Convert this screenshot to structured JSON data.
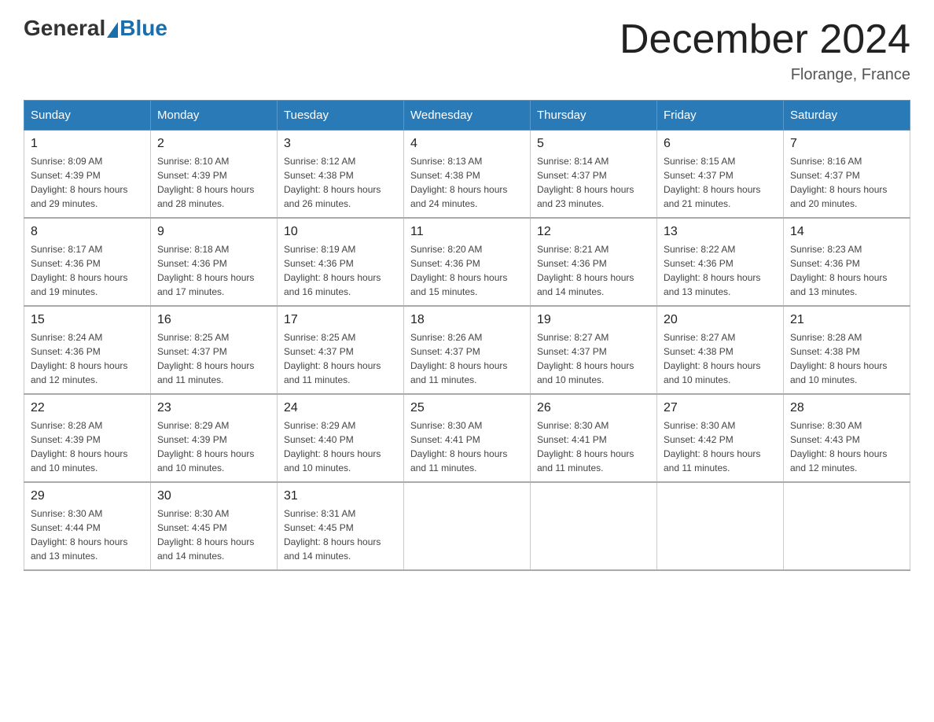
{
  "header": {
    "title": "December 2024",
    "subtitle": "Florange, France",
    "logo_general": "General",
    "logo_blue": "Blue"
  },
  "columns": [
    "Sunday",
    "Monday",
    "Tuesday",
    "Wednesday",
    "Thursday",
    "Friday",
    "Saturday"
  ],
  "weeks": [
    [
      {
        "day": "1",
        "sunrise": "8:09 AM",
        "sunset": "4:39 PM",
        "daylight": "8 hours and 29 minutes."
      },
      {
        "day": "2",
        "sunrise": "8:10 AM",
        "sunset": "4:39 PM",
        "daylight": "8 hours and 28 minutes."
      },
      {
        "day": "3",
        "sunrise": "8:12 AM",
        "sunset": "4:38 PM",
        "daylight": "8 hours and 26 minutes."
      },
      {
        "day": "4",
        "sunrise": "8:13 AM",
        "sunset": "4:38 PM",
        "daylight": "8 hours and 24 minutes."
      },
      {
        "day": "5",
        "sunrise": "8:14 AM",
        "sunset": "4:37 PM",
        "daylight": "8 hours and 23 minutes."
      },
      {
        "day": "6",
        "sunrise": "8:15 AM",
        "sunset": "4:37 PM",
        "daylight": "8 hours and 21 minutes."
      },
      {
        "day": "7",
        "sunrise": "8:16 AM",
        "sunset": "4:37 PM",
        "daylight": "8 hours and 20 minutes."
      }
    ],
    [
      {
        "day": "8",
        "sunrise": "8:17 AM",
        "sunset": "4:36 PM",
        "daylight": "8 hours and 19 minutes."
      },
      {
        "day": "9",
        "sunrise": "8:18 AM",
        "sunset": "4:36 PM",
        "daylight": "8 hours and 17 minutes."
      },
      {
        "day": "10",
        "sunrise": "8:19 AM",
        "sunset": "4:36 PM",
        "daylight": "8 hours and 16 minutes."
      },
      {
        "day": "11",
        "sunrise": "8:20 AM",
        "sunset": "4:36 PM",
        "daylight": "8 hours and 15 minutes."
      },
      {
        "day": "12",
        "sunrise": "8:21 AM",
        "sunset": "4:36 PM",
        "daylight": "8 hours and 14 minutes."
      },
      {
        "day": "13",
        "sunrise": "8:22 AM",
        "sunset": "4:36 PM",
        "daylight": "8 hours and 13 minutes."
      },
      {
        "day": "14",
        "sunrise": "8:23 AM",
        "sunset": "4:36 PM",
        "daylight": "8 hours and 13 minutes."
      }
    ],
    [
      {
        "day": "15",
        "sunrise": "8:24 AM",
        "sunset": "4:36 PM",
        "daylight": "8 hours and 12 minutes."
      },
      {
        "day": "16",
        "sunrise": "8:25 AM",
        "sunset": "4:37 PM",
        "daylight": "8 hours and 11 minutes."
      },
      {
        "day": "17",
        "sunrise": "8:25 AM",
        "sunset": "4:37 PM",
        "daylight": "8 hours and 11 minutes."
      },
      {
        "day": "18",
        "sunrise": "8:26 AM",
        "sunset": "4:37 PM",
        "daylight": "8 hours and 11 minutes."
      },
      {
        "day": "19",
        "sunrise": "8:27 AM",
        "sunset": "4:37 PM",
        "daylight": "8 hours and 10 minutes."
      },
      {
        "day": "20",
        "sunrise": "8:27 AM",
        "sunset": "4:38 PM",
        "daylight": "8 hours and 10 minutes."
      },
      {
        "day": "21",
        "sunrise": "8:28 AM",
        "sunset": "4:38 PM",
        "daylight": "8 hours and 10 minutes."
      }
    ],
    [
      {
        "day": "22",
        "sunrise": "8:28 AM",
        "sunset": "4:39 PM",
        "daylight": "8 hours and 10 minutes."
      },
      {
        "day": "23",
        "sunrise": "8:29 AM",
        "sunset": "4:39 PM",
        "daylight": "8 hours and 10 minutes."
      },
      {
        "day": "24",
        "sunrise": "8:29 AM",
        "sunset": "4:40 PM",
        "daylight": "8 hours and 10 minutes."
      },
      {
        "day": "25",
        "sunrise": "8:30 AM",
        "sunset": "4:41 PM",
        "daylight": "8 hours and 11 minutes."
      },
      {
        "day": "26",
        "sunrise": "8:30 AM",
        "sunset": "4:41 PM",
        "daylight": "8 hours and 11 minutes."
      },
      {
        "day": "27",
        "sunrise": "8:30 AM",
        "sunset": "4:42 PM",
        "daylight": "8 hours and 11 minutes."
      },
      {
        "day": "28",
        "sunrise": "8:30 AM",
        "sunset": "4:43 PM",
        "daylight": "8 hours and 12 minutes."
      }
    ],
    [
      {
        "day": "29",
        "sunrise": "8:30 AM",
        "sunset": "4:44 PM",
        "daylight": "8 hours and 13 minutes."
      },
      {
        "day": "30",
        "sunrise": "8:30 AM",
        "sunset": "4:45 PM",
        "daylight": "8 hours and 14 minutes."
      },
      {
        "day": "31",
        "sunrise": "8:31 AM",
        "sunset": "4:45 PM",
        "daylight": "8 hours and 14 minutes."
      },
      null,
      null,
      null,
      null
    ]
  ],
  "labels": {
    "sunrise": "Sunrise:",
    "sunset": "Sunset:",
    "daylight": "Daylight:"
  }
}
